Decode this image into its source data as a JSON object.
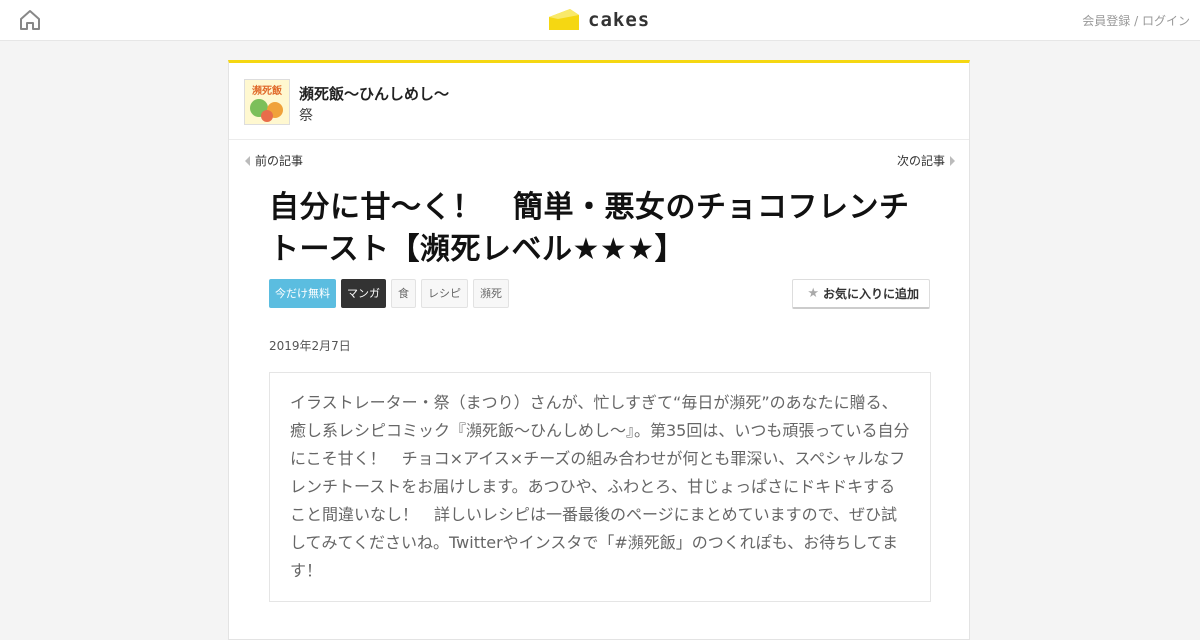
{
  "header": {
    "logo_text": "cakes",
    "auth_register": "会員登録",
    "auth_sep": " / ",
    "auth_login": "ログイン",
    "accent_color": "#f5d712"
  },
  "series": {
    "title": "瀕死飯～ひんしめし～",
    "author": "祭",
    "thumb_caption": "瀕死飯"
  },
  "nav": {
    "prev_label": "前の記事",
    "next_label": "次の記事"
  },
  "article": {
    "title": "自分に甘～く！　簡単・悪女のチョコフレンチトースト【瀕死レベル★★★】",
    "tags": [
      "今だけ無料",
      "マンガ",
      "食",
      "レシピ",
      "瀕死"
    ],
    "favorite_label": "お気に入りに追加",
    "date": "2019年2月7日",
    "lead": "イラストレーター・祭（まつり）さんが、忙しすぎて“毎日が瀕死”のあなたに贈る、癒し系レシピコミック『瀕死飯～ひんしめし～』。第35回は、いつも頑張っている自分にこそ甘く！　チョコ×アイス×チーズの組み合わせが何とも罪深い、スペシャルなフレンチトーストをお届けします。あつひや、ふわとろ、甘じょっぱさにドキドキすること間違いなし！　詳しいレシピは一番最後のページにまとめていますので、ぜひ試してみてくださいね。Twitterやインスタで「#瀕死飯」のつくれぽも、お待ちしてます！"
  },
  "icons": {
    "home": "home-icon",
    "logo": "cheese-logo-icon",
    "star": "star-icon"
  }
}
